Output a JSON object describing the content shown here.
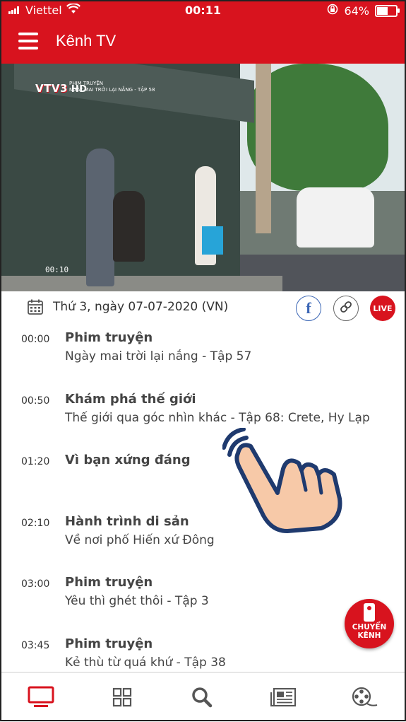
{
  "status_bar": {
    "carrier": "Viettel",
    "time": "00:11",
    "battery_percent": "64%",
    "battery_level": 0.64
  },
  "app_bar": {
    "title": "Kênh TV"
  },
  "video": {
    "channel_logo": "VTV3",
    "hd_label": "HD",
    "caption_line1": "PHIM TRUYỆN",
    "caption_line2": "NGÀY MAI TRỜI LẠI NẮNG - TẬP 58",
    "timecode": "00:10"
  },
  "date_row": {
    "date_text": "Thứ 3, ngày 07-07-2020 (VN)",
    "facebook_label": "f",
    "live_label": "LIVE"
  },
  "schedule": [
    {
      "time": "00:00",
      "title": "Phim truyện",
      "desc": "Ngày mai trời lại nắng - Tập 57"
    },
    {
      "time": "00:50",
      "title": "Khám phá thế giới",
      "desc": "Thế giới qua góc nhìn khác - Tập 68: Crete, Hy Lạp"
    },
    {
      "time": "01:20",
      "title": "Vì bạn xứng đáng",
      "desc": ""
    },
    {
      "time": "02:10",
      "title": "Hành trình di sản",
      "desc": "Về nơi phố Hiến xứ Đông"
    },
    {
      "time": "03:00",
      "title": "Phim truyện",
      "desc": "Yêu thì ghét thôi - Tập 3"
    },
    {
      "time": "03:45",
      "title": "Phim truyện",
      "desc": "Kẻ thù từ quá khứ - Tập 38"
    }
  ],
  "fab": {
    "line1": "CHUYỂN",
    "line2": "KÊNH"
  },
  "colors": {
    "brand_red": "#d8131e",
    "facebook_blue": "#3b66b5"
  },
  "bottom_nav": {
    "items": [
      "tv-icon",
      "grid-icon",
      "search-icon",
      "news-icon",
      "film-reel-icon"
    ],
    "active": "tv-icon"
  }
}
